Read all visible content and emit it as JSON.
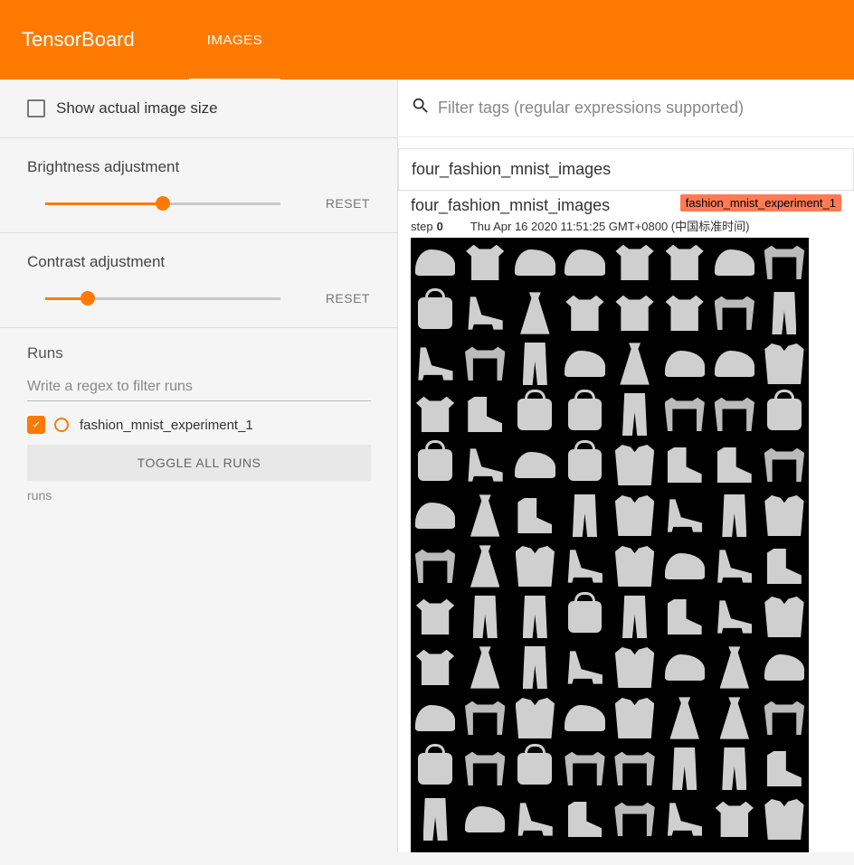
{
  "header": {
    "brand": "TensorBoard",
    "tab_images": "IMAGES"
  },
  "sidebar": {
    "show_actual_size": {
      "label": "Show actual image size",
      "checked": false
    },
    "brightness": {
      "label": "Brightness adjustment",
      "value_pct": 50,
      "reset": "RESET"
    },
    "contrast": {
      "label": "Contrast adjustment",
      "value_pct": 18,
      "reset": "RESET"
    },
    "runs": {
      "title": "Runs",
      "filter_placeholder": "Write a regex to filter runs",
      "items": [
        {
          "name": "fashion_mnist_experiment_1",
          "checked": true,
          "color": "#ff7a00"
        }
      ],
      "toggle_all": "TOGGLE ALL RUNS",
      "label": "runs"
    }
  },
  "panel": {
    "filter_placeholder": "Filter tags (regular expressions supported)",
    "tag_header": "four_fashion_mnist_images",
    "card": {
      "title": "four_fashion_mnist_images",
      "run_badge": "fashion_mnist_experiment_1",
      "step_label": "step",
      "step_value": "0",
      "timestamp": "Thu Apr 16 2020 11:51:25 GMT+0800 (中国标准时间)"
    },
    "grid_classes": [
      "t-shoe",
      "t-shirt",
      "t-shoe",
      "t-shoe",
      "t-shirt",
      "t-shirt",
      "t-shoe",
      "t-sweater",
      "t-bag",
      "t-heel",
      "t-dress",
      "t-shirt",
      "t-shirt",
      "t-shirt",
      "t-sweater",
      "t-pants",
      "t-heel",
      "t-sweater",
      "t-pants",
      "t-shoe",
      "t-dress",
      "t-shoe",
      "t-shoe",
      "t-coat",
      "t-shirt",
      "t-boot",
      "t-bag",
      "t-bag",
      "t-pants",
      "t-sweater",
      "t-sweater",
      "t-bag",
      "t-bag",
      "t-heel",
      "t-shoe",
      "t-bag",
      "t-coat",
      "t-boot",
      "t-boot",
      "t-sweater",
      "t-shoe",
      "t-dress",
      "t-boot",
      "t-pants",
      "t-coat",
      "t-heel",
      "t-pants",
      "t-coat",
      "t-sweater",
      "t-dress",
      "t-coat",
      "t-heel",
      "t-coat",
      "t-shoe",
      "t-heel",
      "t-boot",
      "t-shirt",
      "t-pants",
      "t-pants",
      "t-bag",
      "t-pants",
      "t-boot",
      "t-heel",
      "t-coat",
      "t-shirt",
      "t-dress",
      "t-pants",
      "t-heel",
      "t-coat",
      "t-shoe",
      "t-dress",
      "t-shoe",
      "t-shoe",
      "t-sweater",
      "t-coat",
      "t-shoe",
      "t-coat",
      "t-dress",
      "t-dress",
      "t-sweater",
      "t-bag",
      "t-sweater",
      "t-bag",
      "t-sweater",
      "t-sweater",
      "t-pants",
      "t-pants",
      "t-boot",
      "t-pants",
      "t-shoe",
      "t-heel",
      "t-boot",
      "t-sweater",
      "t-heel",
      "t-shirt",
      "t-coat"
    ]
  }
}
